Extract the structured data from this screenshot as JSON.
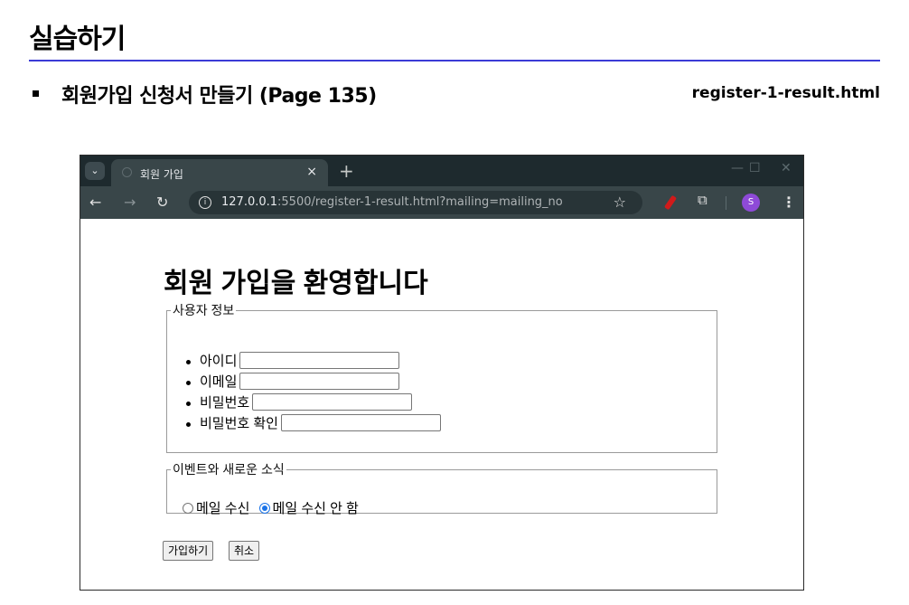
{
  "slide": {
    "title": "실습하기",
    "bullet": "회원가입 신청서 만들기 (Page 135)",
    "file_name": "register-1-result.html"
  },
  "browser": {
    "tab_title": "회원 가입",
    "tab_close": "×",
    "new_tab": "+",
    "window_controls": {
      "minimize": "—",
      "maximize": "☐",
      "close": "✕"
    },
    "url_host": "127.0.0.1",
    "url_rest": ":5500/register-1-result.html?mailing=mailing_no",
    "avatar_letter": "S"
  },
  "page": {
    "heading": "회원 가입을 환영합니다",
    "user_fieldset": {
      "legend": "사용자 정보",
      "fields": [
        {
          "label": "아이디",
          "value": ""
        },
        {
          "label": "이메일",
          "value": ""
        },
        {
          "label": "비밀번호",
          "value": ""
        },
        {
          "label": "비밀번호 확인",
          "value": ""
        }
      ]
    },
    "event_fieldset": {
      "legend": "이벤트와 새로운 소식",
      "options": [
        {
          "label": "메일 수신",
          "checked": false
        },
        {
          "label": "메일 수신 안 함",
          "checked": true
        }
      ]
    },
    "submit_label": "가입하기",
    "cancel_label": "취소"
  },
  "colors": {
    "rule": "#3b3bd6",
    "tabbar": "#1e2a2e",
    "toolbar": "#394649",
    "radio_accent": "#1a73e8",
    "avatar": "#8e4ad8"
  }
}
